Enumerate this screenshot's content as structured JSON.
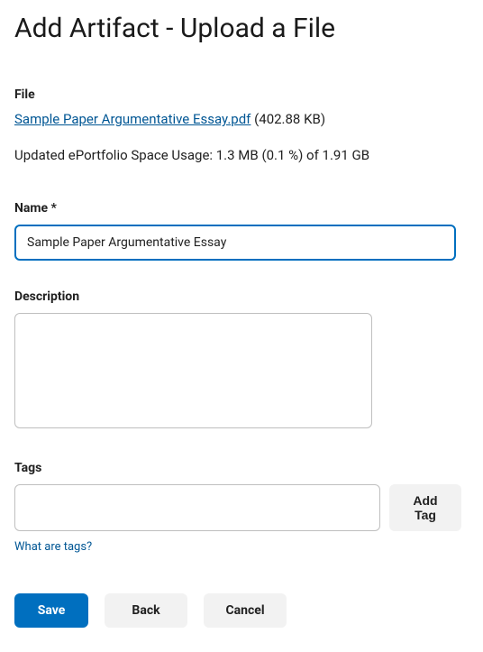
{
  "header": {
    "title": "Add Artifact - Upload a File"
  },
  "file_section": {
    "label": "File",
    "filename": "Sample Paper Argumentative Essay.pdf",
    "filesize": "(402.88 KB)"
  },
  "usage_line": "Updated ePortfolio Space Usage: 1.3 MB (0.1 %) of 1.91 GB",
  "name_field": {
    "label": "Name *",
    "value": "Sample Paper Argumentative Essay"
  },
  "description_field": {
    "label": "Description",
    "value": ""
  },
  "tags_field": {
    "label": "Tags",
    "value": "",
    "add_button": "Add Tag",
    "help_link": "What are tags?"
  },
  "buttons": {
    "save": "Save",
    "back": "Back",
    "cancel": "Cancel"
  }
}
